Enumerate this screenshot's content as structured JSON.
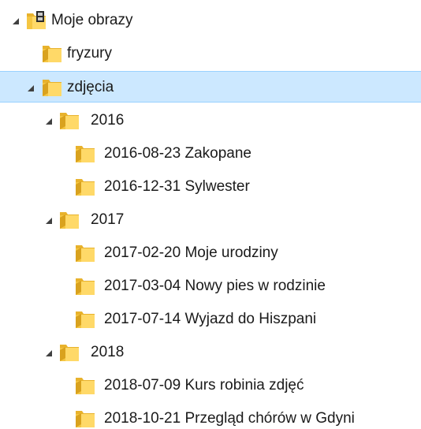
{
  "tree": {
    "nodes": [
      {
        "label": "Moje obrazy",
        "level": 0,
        "expanded": true,
        "icon": "library-folder-icon",
        "selected": false
      },
      {
        "label": "fryzury",
        "level": 1,
        "expanded": null,
        "icon": "folder-icon",
        "selected": false
      },
      {
        "label": "zdjęcia",
        "level": 1,
        "expanded": true,
        "icon": "folder-icon",
        "selected": true
      },
      {
        "label": "2016",
        "level": 2,
        "expanded": true,
        "icon": "folder-icon",
        "selected": false
      },
      {
        "label": "2016-08-23 Zakopane",
        "level": 3,
        "expanded": null,
        "icon": "folder-icon",
        "selected": false
      },
      {
        "label": "2016-12-31 Sylwester",
        "level": 3,
        "expanded": null,
        "icon": "folder-icon",
        "selected": false
      },
      {
        "label": "2017",
        "level": 2,
        "expanded": true,
        "icon": "folder-icon",
        "selected": false
      },
      {
        "label": "2017-02-20 Moje urodziny",
        "level": 3,
        "expanded": null,
        "icon": "folder-icon",
        "selected": false
      },
      {
        "label": "2017-03-04 Nowy pies w rodzinie",
        "level": 3,
        "expanded": null,
        "icon": "folder-icon",
        "selected": false
      },
      {
        "label": "2017-07-14 Wyjazd do Hiszpani",
        "level": 3,
        "expanded": null,
        "icon": "folder-icon",
        "selected": false
      },
      {
        "label": "2018",
        "level": 2,
        "expanded": true,
        "icon": "folder-icon",
        "selected": false
      },
      {
        "label": "2018-07-09 Kurs robinia zdjęć",
        "level": 3,
        "expanded": null,
        "icon": "folder-icon",
        "selected": false
      },
      {
        "label": "2018-10-21 Przegląd chórów w Gdyni",
        "level": 3,
        "expanded": null,
        "icon": "folder-icon",
        "selected": false
      }
    ]
  },
  "colors": {
    "selection_bg": "#cce8ff",
    "selection_border": "#99d1ff",
    "folder_body": "#f5c642",
    "folder_front": "#ffd968",
    "folder_tab": "#e8b22c",
    "expander": "#404040"
  }
}
